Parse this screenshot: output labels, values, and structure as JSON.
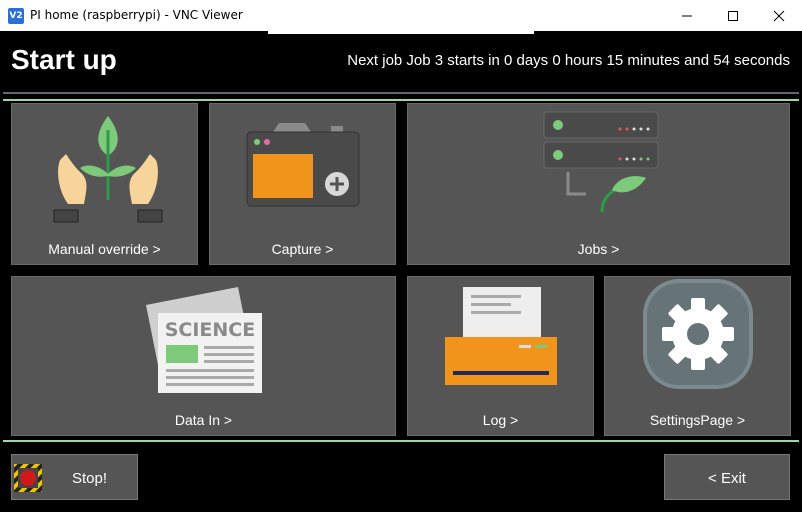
{
  "window": {
    "title": "PI home (raspberrypi) - VNC Viewer",
    "logo_text": "V2",
    "controls": [
      "minimize-icon",
      "maximize-icon",
      "close-icon"
    ]
  },
  "header": {
    "title": "Start up",
    "next_job": "Next job Job 3 starts in 0 days 0 hours 15 minutes and 54 seconds"
  },
  "tiles": {
    "manual_override": {
      "label": "Manual override >",
      "icon": "hands-plant-icon"
    },
    "capture": {
      "label": "Capture >",
      "icon": "camera-icon"
    },
    "jobs": {
      "label": "Jobs >",
      "icon": "servers-leaf-icon"
    },
    "data_in": {
      "label": "Data In >",
      "icon": "newspaper-icon",
      "icon_text": "SCIENCE"
    },
    "log": {
      "label": "Log >",
      "icon": "printer-icon"
    },
    "settings": {
      "label": "SettingsPage >",
      "icon": "gear-icon"
    }
  },
  "footer": {
    "stop_label": "Stop!",
    "exit_label": "< Exit"
  },
  "colors": {
    "tile_bg": "#555555",
    "accent_green": "#9fd6a8",
    "orange": "#f0941b"
  }
}
